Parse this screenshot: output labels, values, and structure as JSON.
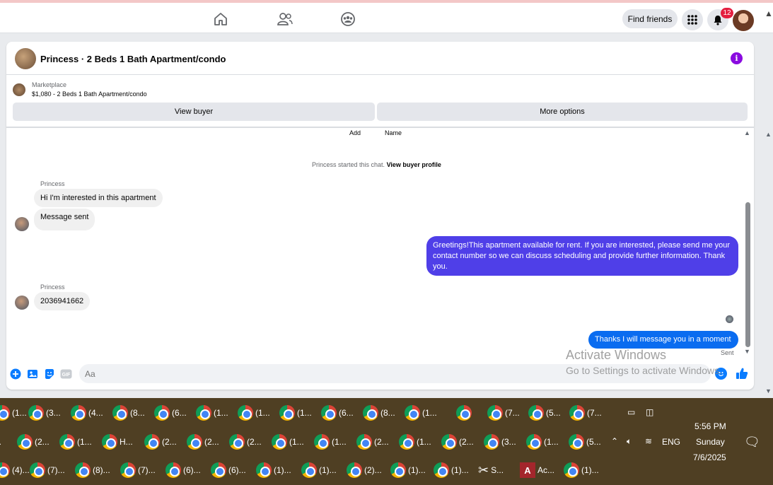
{
  "top": {
    "find_friends": "Find friends",
    "notif_count": "12"
  },
  "chat": {
    "title": "Princess · 2 Beds 1 Bath Apartment/condo",
    "marketplace_label": "Marketplace",
    "listing": "$1,080 - 2 Beds 1 Bath Apartment/condo",
    "view_buyer": "View buyer",
    "more_options": "More options",
    "add": "Add",
    "name": "Name",
    "started": "Princess started this chat.",
    "view_profile": "View buyer profile"
  },
  "messages": [
    {
      "sender": "Princess",
      "text": "Hi I'm interested in this apartment"
    },
    {
      "text": "Message sent"
    },
    {
      "text": "Greetings!This  apartment available for rent. If you are interested, please send me your contact number so we can discuss scheduling and provide further information. Thank you."
    },
    {
      "sender": "Princess",
      "text": "2036941662"
    },
    {
      "text": "Thanks I will message you in a moment",
      "status": "Sent"
    }
  ],
  "composer": {
    "placeholder": "Aa"
  },
  "watermark": {
    "line1": "Activate Windows",
    "line2": "Go to Settings to activate Windows."
  },
  "taskbar": {
    "row1": [
      "(1...",
      "(3...",
      "(4...",
      "(8...",
      "(6...",
      "(1...",
      "(1...",
      "(1...",
      "(6...",
      "(8...",
      "(1...",
      "",
      "(7...",
      "(5...",
      "(7..."
    ],
    "row2": [
      "...",
      "(2...",
      "(1...",
      "H...",
      "(2...",
      "(2...",
      "(2...",
      "(1...",
      "(1...",
      "(2...",
      "(1...",
      "(2...",
      "(3...",
      "(1...",
      "(5..."
    ],
    "row3": [
      "(4)...",
      "(7)...",
      "(8)...",
      "(7)...",
      "(6)...",
      "(6)...",
      "(1)...",
      "(1)...",
      "(2)...",
      "(1)...",
      "(1)...",
      "S...",
      "Ac...",
      "(1)..."
    ],
    "lang": "ENG",
    "time": "5:56 PM",
    "day": "Sunday",
    "date": "7/6/2025"
  },
  "colors": {
    "accent": "#0a7cff",
    "bubble_purple": "#4f3fe8",
    "bubble_blue": "#0a6cf0",
    "info": "#8a0be0"
  }
}
